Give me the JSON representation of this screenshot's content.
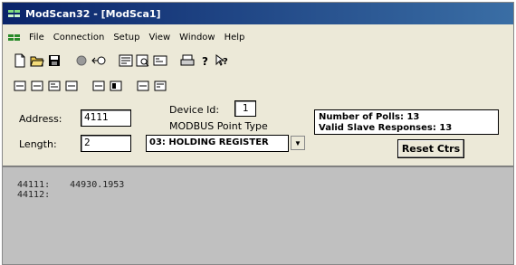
{
  "window": {
    "title": "ModScan32 - [ModSca1]"
  },
  "menubar": {
    "items": [
      "File",
      "Connection",
      "Setup",
      "View",
      "Window",
      "Help"
    ]
  },
  "toolbar": {
    "row1": [
      "new-icon",
      "open-icon",
      "save-icon",
      "connect-icon",
      "disconnect-icon",
      "display-options-icon",
      "print-preview-icon",
      "config-icon",
      "print-icon",
      "help-icon",
      "context-help-icon"
    ],
    "row2": [
      "binary-display-icon",
      "decimal-display-icon",
      "hex-display-icon",
      "float-display-icon",
      "swapped-float-icon",
      "double-icon",
      "show-traffic-icon",
      "data-log-icon"
    ]
  },
  "form": {
    "address_label": "Address:",
    "address_value": "4111",
    "length_label": "Length:",
    "length_value": "2",
    "device_id_label": "Device Id:",
    "device_id_value": "1",
    "point_type_label": "MODBUS Point Type",
    "point_type_value": "03: HOLDING REGISTER"
  },
  "stats": {
    "polls": "Number of Polls: 13",
    "responses": "Valid Slave Responses: 13",
    "reset_label": "Reset Ctrs"
  },
  "data": {
    "rows": [
      {
        "address": "44111:",
        "value": "44930.1953"
      },
      {
        "address": "44112:",
        "value": ""
      }
    ]
  }
}
